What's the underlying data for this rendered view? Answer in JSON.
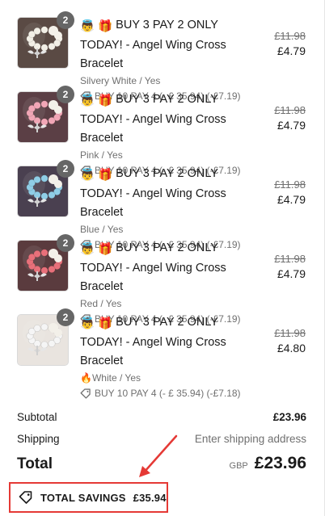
{
  "items": [
    {
      "qty": "2",
      "title": "BUY 3 PAY 2 ONLY TODAY! - Angel Wing Cross Bracelet",
      "variant": "Silvery White / Yes",
      "variant_prefix": "",
      "promo": "BUY 10 PAY 4 (- £ 35.94) (-£7.19)",
      "original_price": "£11.98",
      "price": "£4.79",
      "bead_color": "#f2efe6",
      "bg": "#5a4a44"
    },
    {
      "qty": "2",
      "title": "BUY 3 PAY 2 ONLY TODAY! - Angel Wing Cross Bracelet",
      "variant": "Pink / Yes",
      "variant_prefix": "",
      "promo": "BUY 10 PAY 4 (- £ 35.94) (-£7.19)",
      "original_price": "£11.98",
      "price": "£4.79",
      "bead_color": "#f1a6b6",
      "bg": "#5b3f45"
    },
    {
      "qty": "2",
      "title": "BUY 3 PAY 2 ONLY TODAY! - Angel Wing Cross Bracelet",
      "variant": "Blue / Yes",
      "variant_prefix": "",
      "promo": "BUY 10 PAY 4 (- £ 35.94) (-£7.19)",
      "original_price": "£11.98",
      "price": "£4.79",
      "bead_color": "#8fcde6",
      "bg": "#4a4050"
    },
    {
      "qty": "2",
      "title": "BUY 3 PAY 2 ONLY TODAY! - Angel Wing Cross Bracelet",
      "variant": "Red / Yes",
      "variant_prefix": "",
      "promo": "BUY 10 PAY 4 (- £ 35.94) (-£7.19)",
      "original_price": "£11.98",
      "price": "£4.79",
      "bead_color": "#e8707a",
      "bg": "#5a3b3e"
    },
    {
      "qty": "2",
      "title": "BUY 3 PAY 2 ONLY TODAY! - Angel Wing Cross Bracelet",
      "variant": "White / Yes",
      "variant_prefix": "🔥",
      "promo": "BUY 10 PAY 4 (- £ 35.94) (-£7.18)",
      "original_price": "£11.98",
      "price": "£4.80",
      "bead_color": "#f5f5f5",
      "bg": "#e9e4df"
    }
  ],
  "title_emojis": "👼 🎁",
  "summary": {
    "subtotal_label": "Subtotal",
    "subtotal_value": "£23.96",
    "shipping_label": "Shipping",
    "shipping_value": "Enter shipping address",
    "total_label": "Total",
    "currency": "GBP",
    "total_value": "£23.96"
  },
  "savings": {
    "label": "TOTAL SAVINGS",
    "value": "£35.94",
    "highlight_color": "#e53935"
  }
}
